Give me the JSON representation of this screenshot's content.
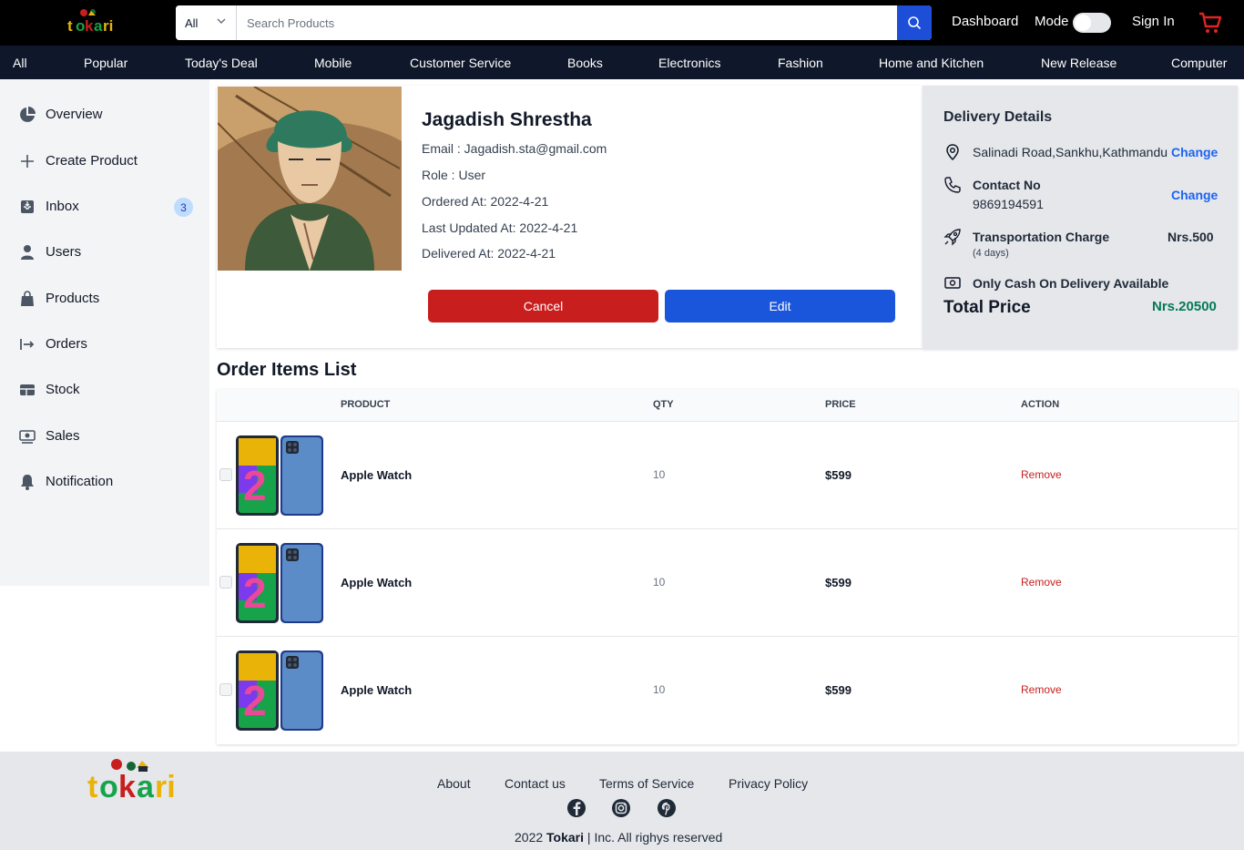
{
  "header": {
    "logo_text": "tokari",
    "search": {
      "category": "All",
      "placeholder": "Search Products"
    },
    "dashboard": "Dashboard",
    "mode": "Mode",
    "sign_in": "Sign In"
  },
  "categories": [
    "All",
    "Popular",
    "Today's Deal",
    "Mobile",
    "Customer Service",
    "Books",
    "Electronics",
    "Fashion",
    "Home and Kitchen",
    "New Release",
    "Computer"
  ],
  "sidebar": {
    "items": [
      {
        "label": "Overview",
        "icon": "pie-chart-icon"
      },
      {
        "label": "Create Product",
        "icon": "plus-icon"
      },
      {
        "label": "Inbox",
        "icon": "inbox-icon",
        "badge": "3"
      },
      {
        "label": "Users",
        "icon": "user-icon"
      },
      {
        "label": "Products",
        "icon": "shopping-bag-icon"
      },
      {
        "label": "Orders",
        "icon": "arrow-right-bar-icon"
      },
      {
        "label": "Stock",
        "icon": "table-icon"
      },
      {
        "label": "Sales",
        "icon": "cash-icon"
      },
      {
        "label": "Notification",
        "icon": "bell-icon"
      }
    ]
  },
  "profile": {
    "name": "Jagadish Shrestha",
    "email": "Email : Jagadish.sta@gmail.com",
    "role": "Role : User",
    "ordered": "Ordered At: 2022-4-21",
    "updated": "Last Updated At: 2022-4-21",
    "delivered": "Delivered At: 2022-4-21",
    "cancel": "Cancel",
    "edit": "Edit"
  },
  "delivery": {
    "title": "Delivery Details",
    "address": "Salinadi Road,Sankhu,Kathmandu",
    "change": "Change",
    "contact_label": "Contact No",
    "contact_value": "9869194591",
    "transport_label": "Transportation Charge",
    "transport_days": "(4 days)",
    "transport_price": "Nrs.500",
    "cod": "Only Cash On Delivery Available",
    "total_label": "Total Price",
    "total_value": "Nrs.20500"
  },
  "orders": {
    "title": "Order Items List",
    "columns": [
      "PRODUCT",
      "QTY",
      "PRICE",
      "ACTION"
    ],
    "rows": [
      {
        "product": "Apple Watch",
        "qty": "10",
        "price": "$599",
        "action": "Remove"
      },
      {
        "product": "Apple Watch",
        "qty": "10",
        "price": "$599",
        "action": "Remove"
      },
      {
        "product": "Apple Watch",
        "qty": "10",
        "price": "$599",
        "action": "Remove"
      }
    ]
  },
  "footer": {
    "links": [
      "About",
      "Contact us",
      "Terms of Service",
      "Privacy Policy"
    ],
    "social": [
      "facebook-icon",
      "instagram-icon",
      "pinterest-icon"
    ],
    "copyright_year": "2022",
    "copyright_brand": "Tokari",
    "copyright_rest": "|  Inc. All righys reserved"
  },
  "colors": {
    "cancel": "#c81e1e",
    "edit": "#1a56db",
    "total": "#057a55",
    "accent": "#1c64f2",
    "cart": "#e02424"
  }
}
